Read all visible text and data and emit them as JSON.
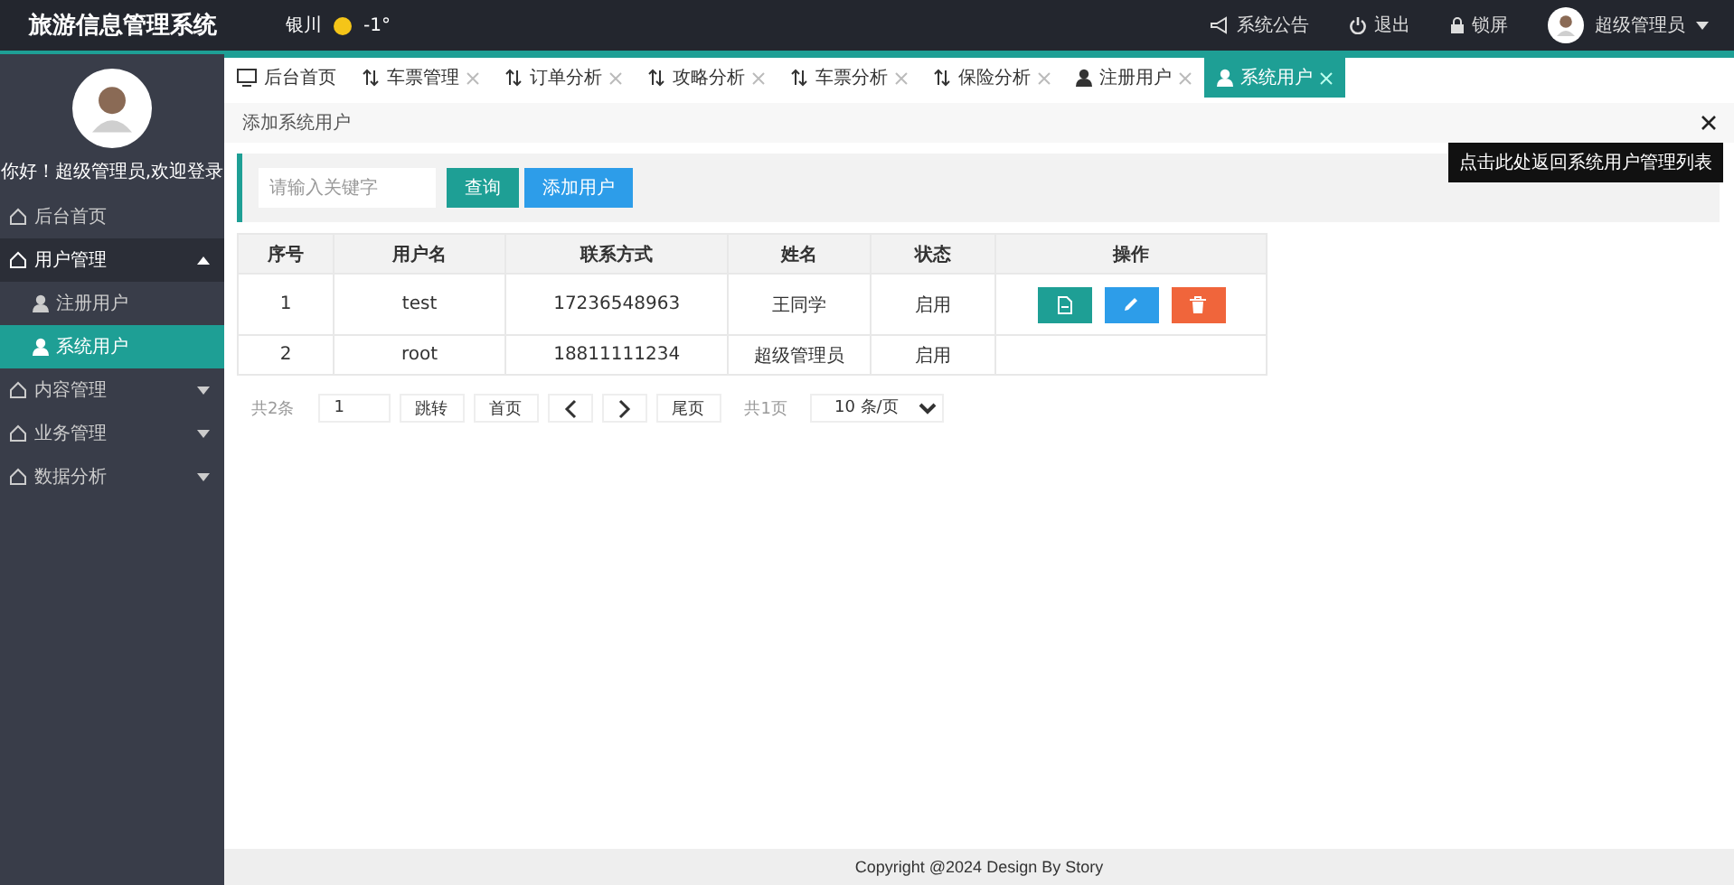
{
  "app": {
    "title": "旅游信息管理系统"
  },
  "weather": {
    "city": "银川",
    "temperature": "-1°"
  },
  "top_links": [
    {
      "kind": "notice",
      "label": "系统公告"
    },
    {
      "kind": "logout",
      "label": "退出"
    },
    {
      "kind": "lock",
      "label": "锁屏"
    }
  ],
  "user_menu": {
    "label": "超级管理员"
  },
  "sidebar": {
    "welcome": "你好！超级管理员,欢迎登录",
    "items": [
      {
        "label": "后台首页",
        "kind": "link"
      },
      {
        "label": "用户管理",
        "kind": "group",
        "expanded": true,
        "children": [
          {
            "label": "注册用户",
            "selected": false
          },
          {
            "label": "系统用户",
            "selected": true
          }
        ]
      },
      {
        "label": "内容管理",
        "kind": "group",
        "expanded": false
      },
      {
        "label": "业务管理",
        "kind": "group",
        "expanded": false
      },
      {
        "label": "数据分析",
        "kind": "group",
        "expanded": false
      }
    ]
  },
  "tabs": [
    {
      "label": "后台首页",
      "kind": "home",
      "closable": false,
      "selected": false
    },
    {
      "label": "车票管理",
      "kind": "analysis",
      "closable": true,
      "selected": false
    },
    {
      "label": "订单分析",
      "kind": "analysis",
      "closable": true,
      "selected": false
    },
    {
      "label": "攻略分析",
      "kind": "analysis",
      "closable": true,
      "selected": false
    },
    {
      "label": "车票分析",
      "kind": "analysis",
      "closable": true,
      "selected": false
    },
    {
      "label": "保险分析",
      "kind": "analysis",
      "closable": true,
      "selected": false
    },
    {
      "label": "注册用户",
      "kind": "user",
      "closable": true,
      "selected": false
    },
    {
      "label": "系统用户",
      "kind": "user",
      "closable": true,
      "selected": true
    }
  ],
  "page": {
    "title": "添加系统用户",
    "close_tooltip": "点击此处返回系统用户管理列表"
  },
  "toolbar": {
    "search": {
      "placeholder": "请输入关键字"
    },
    "buttons": [
      {
        "kind": "search",
        "label": "查询"
      },
      {
        "kind": "add",
        "label": "添加用户"
      }
    ]
  },
  "table": {
    "columns": [
      "序号",
      "用户名",
      "联系方式",
      "姓名",
      "状态",
      "操作"
    ],
    "rows": [
      {
        "cells": [
          "1",
          "test",
          "17236548963",
          "王同学",
          "启用"
        ],
        "actions": true
      },
      {
        "cells": [
          "2",
          "root",
          "18811111234",
          "超级管理员",
          "启用"
        ],
        "actions": false
      }
    ]
  },
  "pager": {
    "total": "共2条",
    "page_input": "1",
    "jump": "跳转",
    "first": "首页",
    "last": "尾页",
    "pages": "共1页",
    "page_size": "10 条/页"
  },
  "footer": {
    "copyright": "Copyright @2024 Design By Story"
  }
}
